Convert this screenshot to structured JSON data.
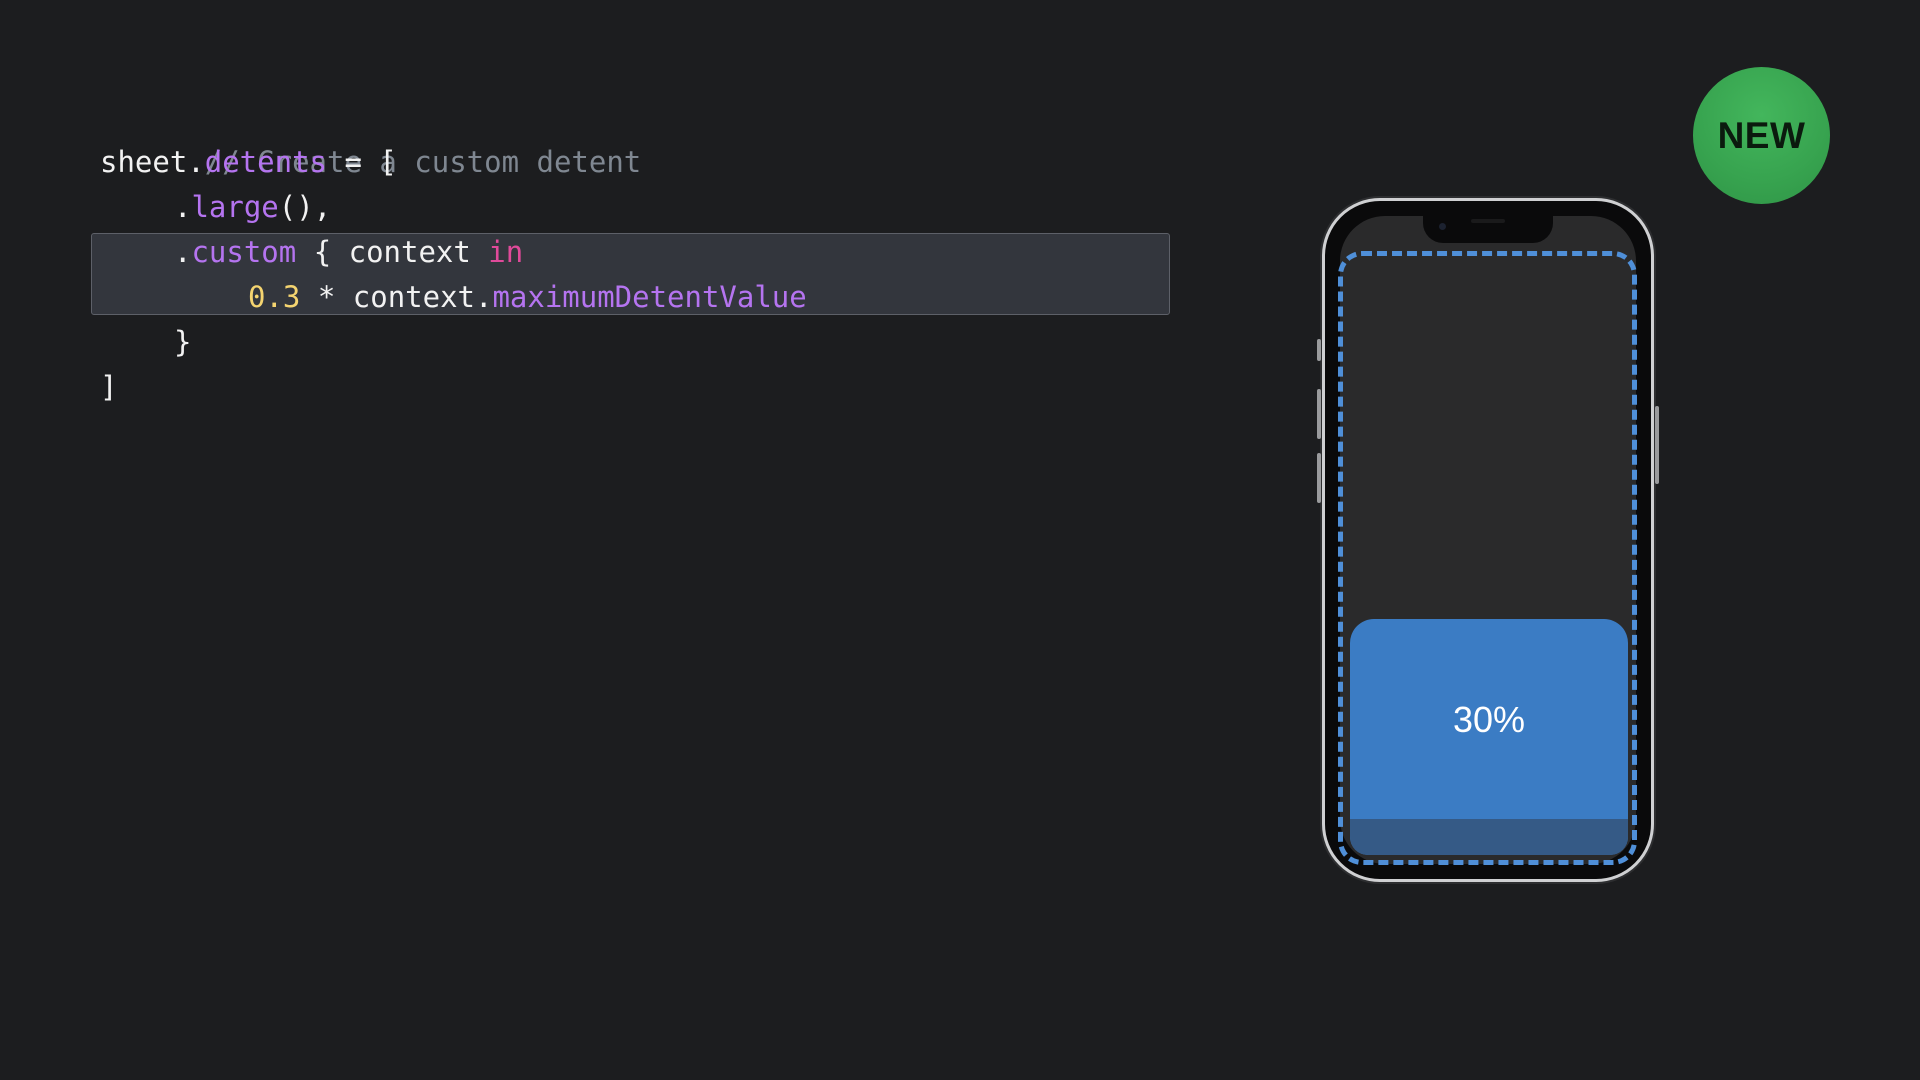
{
  "code": {
    "comment": "// Create a custom detent",
    "line2": {
      "receiver": "sheet.",
      "property": "detents",
      "rest": " = ["
    },
    "line3": {
      "dot": ".",
      "member": "large",
      "rest": "(),"
    },
    "line4": {
      "dot": ".",
      "member": "custom",
      "brace": " { context ",
      "keyword": "in"
    },
    "line5": {
      "number": "0.3",
      "op": " * context.",
      "member": "maximumDetentValue"
    },
    "line6": "}",
    "line7": "]"
  },
  "badge": {
    "label": "NEW",
    "color": "#3aa853"
  },
  "phone": {
    "sheet_label": "30%",
    "sheet_fraction": 0.3,
    "sheet_color": "#3b7cc4",
    "outline_color": "#4f8fd8"
  }
}
